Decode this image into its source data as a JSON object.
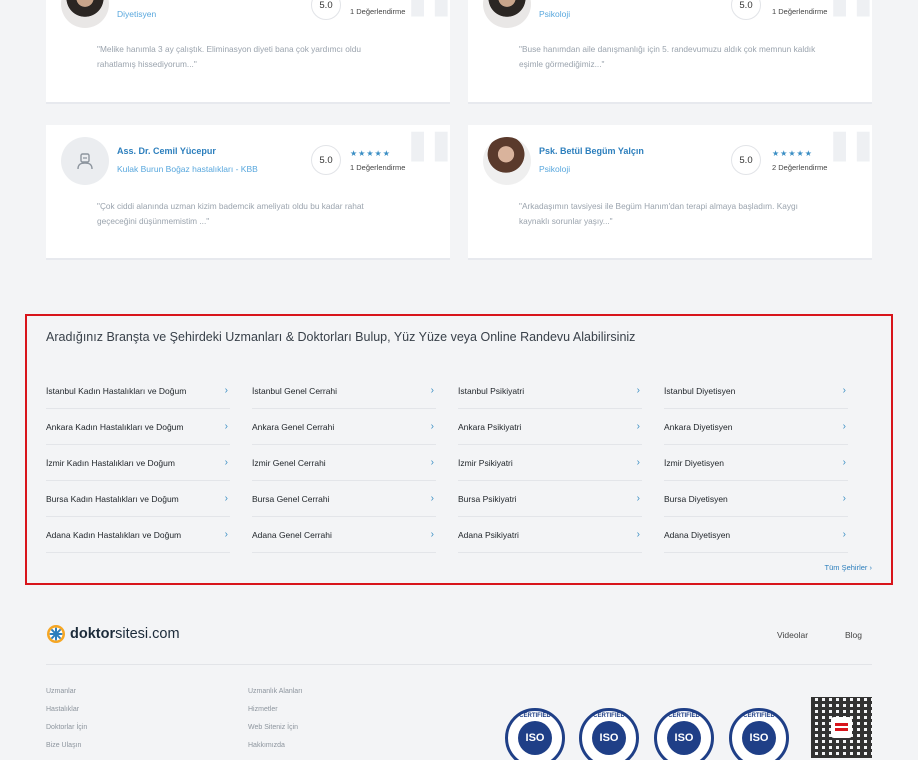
{
  "reviews": [
    {
      "name": "",
      "specialty": "Diyetisyen",
      "score": "5.0",
      "stars": "★★★★★",
      "review_count": "1 Değerlendirme",
      "text": "\"Melike hanımla 3 ay çalıştık. Eliminasyon diyeti bana çok yardımcı oldu rahatlamış hissediyorum...\""
    },
    {
      "name": "",
      "specialty": "Psikoloji",
      "score": "5.0",
      "stars": "★★★★★",
      "review_count": "1 Değerlendirme",
      "text": "\"Buse hanımdan aile danışmanlığı için 5. randevumuzu aldık çok memnun kaldık eşimle görmediğimiz...\""
    },
    {
      "name": "Ass. Dr. Cemil Yücepur",
      "specialty": "Kulak Burun Boğaz hastalıkları - KBB",
      "score": "5.0",
      "stars": "★★★★★",
      "review_count": "1 Değerlendirme",
      "text": "\"Çok ciddi alanında uzman kizim bademcik ameliyatı oldu bu kadar rahat geçeceğini düşünmemistim ...\""
    },
    {
      "name": "Psk. Betül Begüm Yalçın",
      "specialty": "Psikoloji",
      "score": "5.0",
      "stars": "★★★★★",
      "review_count": "2 Değerlendirme",
      "text": "\"Arkadaşımın tavsiyesi ile Begüm Hanım'dan terapi almaya başladım. Kaygı kaynaklı sorunlar yaşıy...\""
    }
  ],
  "branch_section": {
    "title": "Aradığınız Branşta ve Şehirdeki Uzmanları & Doktorları Bulup, Yüz Yüze veya Online Randevu Alabilirsiniz",
    "chevron": "›",
    "columns": [
      [
        "İstanbul Kadın Hastalıkları ve Doğum",
        "Ankara Kadın Hastalıkları ve Doğum",
        "İzmir Kadın Hastalıkları ve Doğum",
        "Bursa Kadın Hastalıkları ve Doğum",
        "Adana Kadın Hastalıkları ve Doğum"
      ],
      [
        "İstanbul Genel Cerrahi",
        "Ankara Genel Cerrahi",
        "İzmir Genel Cerrahi",
        "Bursa Genel Cerrahi",
        "Adana Genel Cerrahi"
      ],
      [
        "İstanbul Psikiyatri",
        "Ankara Psikiyatri",
        "İzmir Psikiyatri",
        "Bursa Psikiyatri",
        "Adana Psikiyatri"
      ],
      [
        "İstanbul Diyetisyen",
        "Ankara Diyetisyen",
        "İzmir Diyetisyen",
        "Bursa Diyetisyen",
        "Adana Diyetisyen"
      ]
    ],
    "all_cities": "Tüm Şehirler ›"
  },
  "footer": {
    "logo_bold": "doktor",
    "logo_rest": "sitesi.com",
    "nav": [
      "Videolar",
      "Blog"
    ],
    "links_col1": [
      "Uzmanlar",
      "Hastalıklar",
      "Doktorlar İçin",
      "Bize Ulaşın"
    ],
    "links_col2": [
      "Uzmanlık Alanları",
      "Hizmetler",
      "Web Siteniz İçin",
      "Hakkımızda"
    ],
    "cert_label": "CERTIFIED",
    "iso_label": "ISO"
  },
  "colors": {
    "accent": "#2d7fbd",
    "highlight_border": "#d8141b",
    "iso_blue": "#1f3f87"
  }
}
